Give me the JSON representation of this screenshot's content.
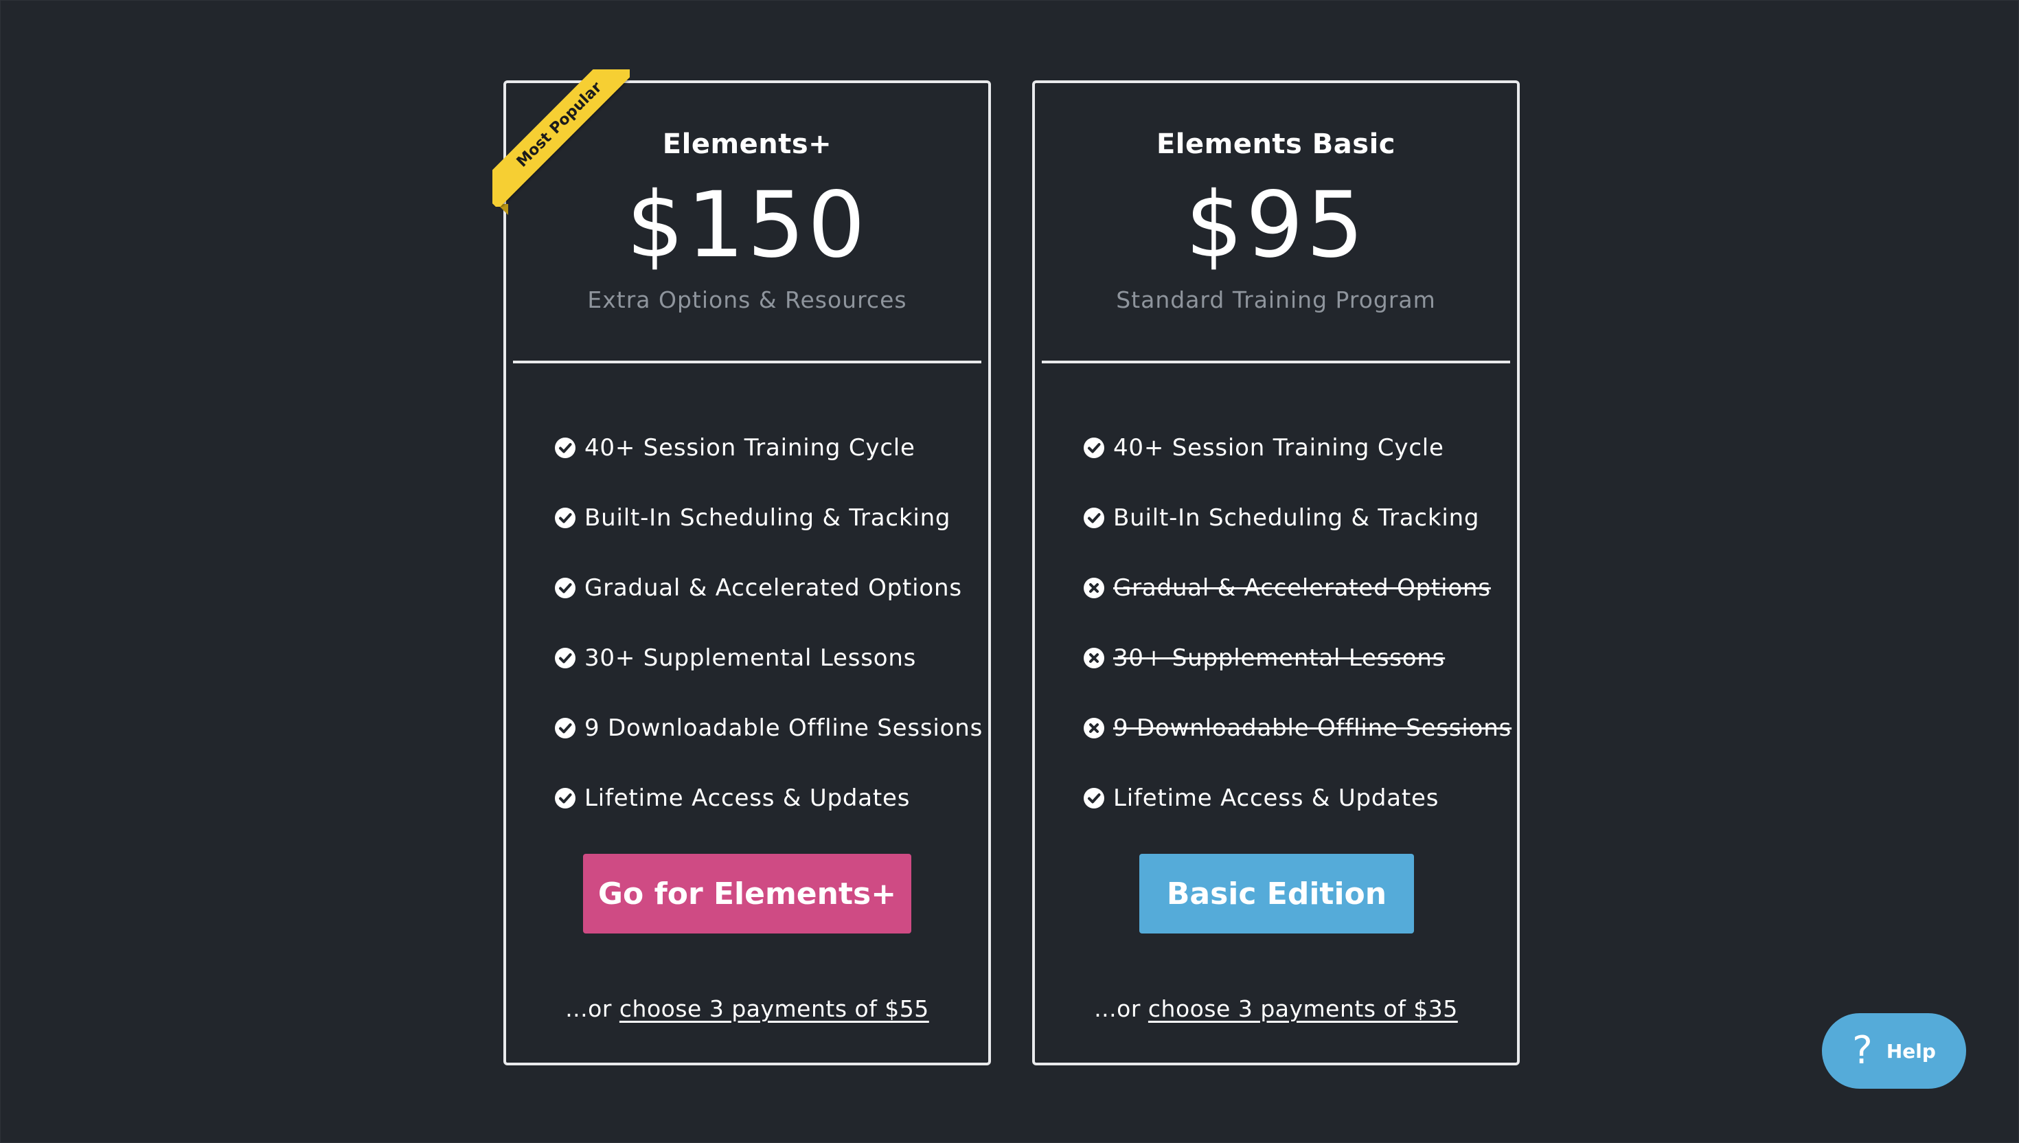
{
  "plans": [
    {
      "badge": "Most Popular",
      "name": "Elements+",
      "price": "$150",
      "subtitle": "Extra Options & Resources",
      "features": [
        {
          "label": "40+ Session Training Cycle",
          "included": true
        },
        {
          "label": "Built-In Scheduling & Tracking",
          "included": true
        },
        {
          "label": "Gradual & Accelerated Options",
          "included": true
        },
        {
          "label": "30+ Supplemental Lessons",
          "included": true
        },
        {
          "label": "9 Downloadable Offline Sessions",
          "included": true
        },
        {
          "label": "Lifetime Access & Updates",
          "included": true
        }
      ],
      "cta_label": "Go for Elements+",
      "cta_color": "#cf4b84",
      "alt_prefix": "...or ",
      "alt_link": "choose 3 payments of $55"
    },
    {
      "name": "Elements Basic",
      "price": "$95",
      "subtitle": "Standard Training Program",
      "features": [
        {
          "label": "40+ Session Training Cycle",
          "included": true
        },
        {
          "label": "Built-In Scheduling & Tracking",
          "included": true
        },
        {
          "label": "Gradual & Accelerated Options",
          "included": false
        },
        {
          "label": "30+ Supplemental Lessons",
          "included": false
        },
        {
          "label": "9 Downloadable Offline Sessions",
          "included": false
        },
        {
          "label": "Lifetime Access & Updates",
          "included": true
        }
      ],
      "cta_label": "Basic Edition",
      "cta_color": "#55abd9",
      "alt_prefix": "...or ",
      "alt_link": "choose 3 payments of $35"
    }
  ],
  "help": {
    "icon": "question-icon",
    "label": "Help"
  },
  "icons": {
    "included": "check-circle-icon",
    "excluded": "x-circle-icon"
  },
  "colors": {
    "background": "#22262c",
    "ribbon": "#f6cf33",
    "card_border": "#e9eaec"
  }
}
